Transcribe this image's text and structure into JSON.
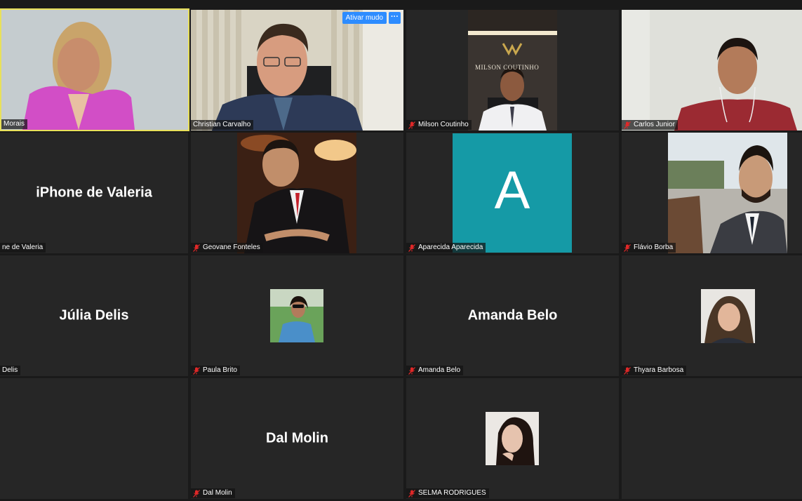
{
  "participants": [
    {
      "name": "Morais",
      "row": 0,
      "col": 0,
      "muted": false
    },
    {
      "name": "Christian Carvalho",
      "row": 0,
      "col": 1,
      "muted": false
    },
    {
      "name": "Milson Coutinho",
      "row": 0,
      "col": 2,
      "muted": true
    },
    {
      "name": "Carlos Junior",
      "row": 0,
      "col": 3,
      "muted": true
    },
    {
      "name": "iPhone de Valeria",
      "label": "ne de Valeria",
      "row": 1,
      "col": 0,
      "muted": false
    },
    {
      "name": "Geovane Fonteles",
      "row": 1,
      "col": 1,
      "muted": true
    },
    {
      "name": "Aparecida Aparecida",
      "row": 1,
      "col": 2,
      "muted": true
    },
    {
      "name": "Flávio Borba",
      "row": 1,
      "col": 3,
      "muted": true
    },
    {
      "name": "Júlia Delis",
      "label": "Delis",
      "row": 2,
      "col": 0,
      "muted": false
    },
    {
      "name": "Paula Brito",
      "row": 2,
      "col": 1,
      "muted": true
    },
    {
      "name": "Amanda Belo",
      "row": 2,
      "col": 2,
      "muted": true
    },
    {
      "name": "Thyara Barbosa",
      "row": 2,
      "col": 3,
      "muted": true
    },
    {
      "name": "Dal Molin",
      "row": 3,
      "col": 1,
      "muted": true
    },
    {
      "name": "SELMA RODRIGUES",
      "row": 3,
      "col": 2,
      "muted": true
    }
  ],
  "tiles": {
    "morais": {
      "label": "Morais"
    },
    "christian": {
      "label": "Christian Carvalho",
      "unmute_button": "Ativar mudo",
      "more_button": "···"
    },
    "milson": {
      "label": "Milson Coutinho",
      "office_sign": "MILSON COUTINHO"
    },
    "carlos": {
      "label": "Carlos Junior"
    },
    "valeria": {
      "big_name": "iPhone de Valeria",
      "label": "ne de Valeria"
    },
    "geovane": {
      "label": "Geovane Fonteles"
    },
    "aparecida": {
      "avatar_letter": "A",
      "label": "Aparecida Aparecida"
    },
    "flavio": {
      "label": "Flávio Borba"
    },
    "julia": {
      "big_name": "Júlia Delis",
      "label": "Delis"
    },
    "paula": {
      "label": "Paula Brito"
    },
    "amanda": {
      "big_name": "Amanda Belo",
      "label": "Amanda Belo"
    },
    "thyara": {
      "label": "Thyara Barbosa"
    },
    "dal": {
      "big_name": "Dal Molin",
      "label": "Dal Molin"
    },
    "selma": {
      "label": "SELMA RODRIGUES"
    }
  },
  "colors": {
    "background": "#1a1a1a",
    "tile": "#262626",
    "active_speaker_border": "#e8e05a",
    "button_blue": "#2d8cff",
    "muted_icon": "#e02828",
    "avatar_teal": "#159aa6"
  },
  "icons": [
    "mic-muted-icon",
    "more-options-icon"
  ]
}
